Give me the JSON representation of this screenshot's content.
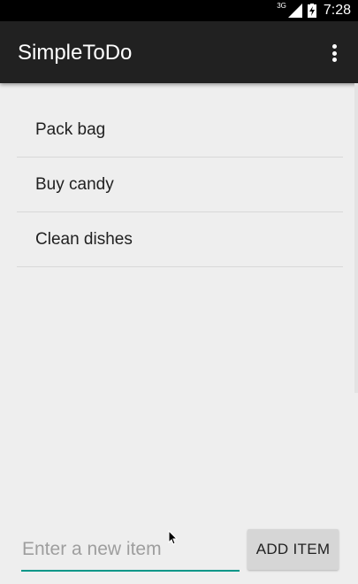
{
  "status_bar": {
    "network": "3G",
    "time": "7:28",
    "icons": [
      "signal-icon",
      "battery-charging-icon"
    ]
  },
  "app_bar": {
    "title": "SimpleToDo",
    "menu_icon": "overflow-menu-icon"
  },
  "todo_list": {
    "items": [
      {
        "label": "Pack bag"
      },
      {
        "label": "Buy candy"
      },
      {
        "label": "Clean dishes"
      }
    ]
  },
  "new_item": {
    "value": "",
    "placeholder": "Enter a new item",
    "underline_color": "#009688"
  },
  "add_button": {
    "label": "ADD ITEM"
  },
  "colors": {
    "app_bar": "#212121",
    "background": "#eeeeee",
    "button": "#d6d6d6",
    "accent": "#009688"
  }
}
